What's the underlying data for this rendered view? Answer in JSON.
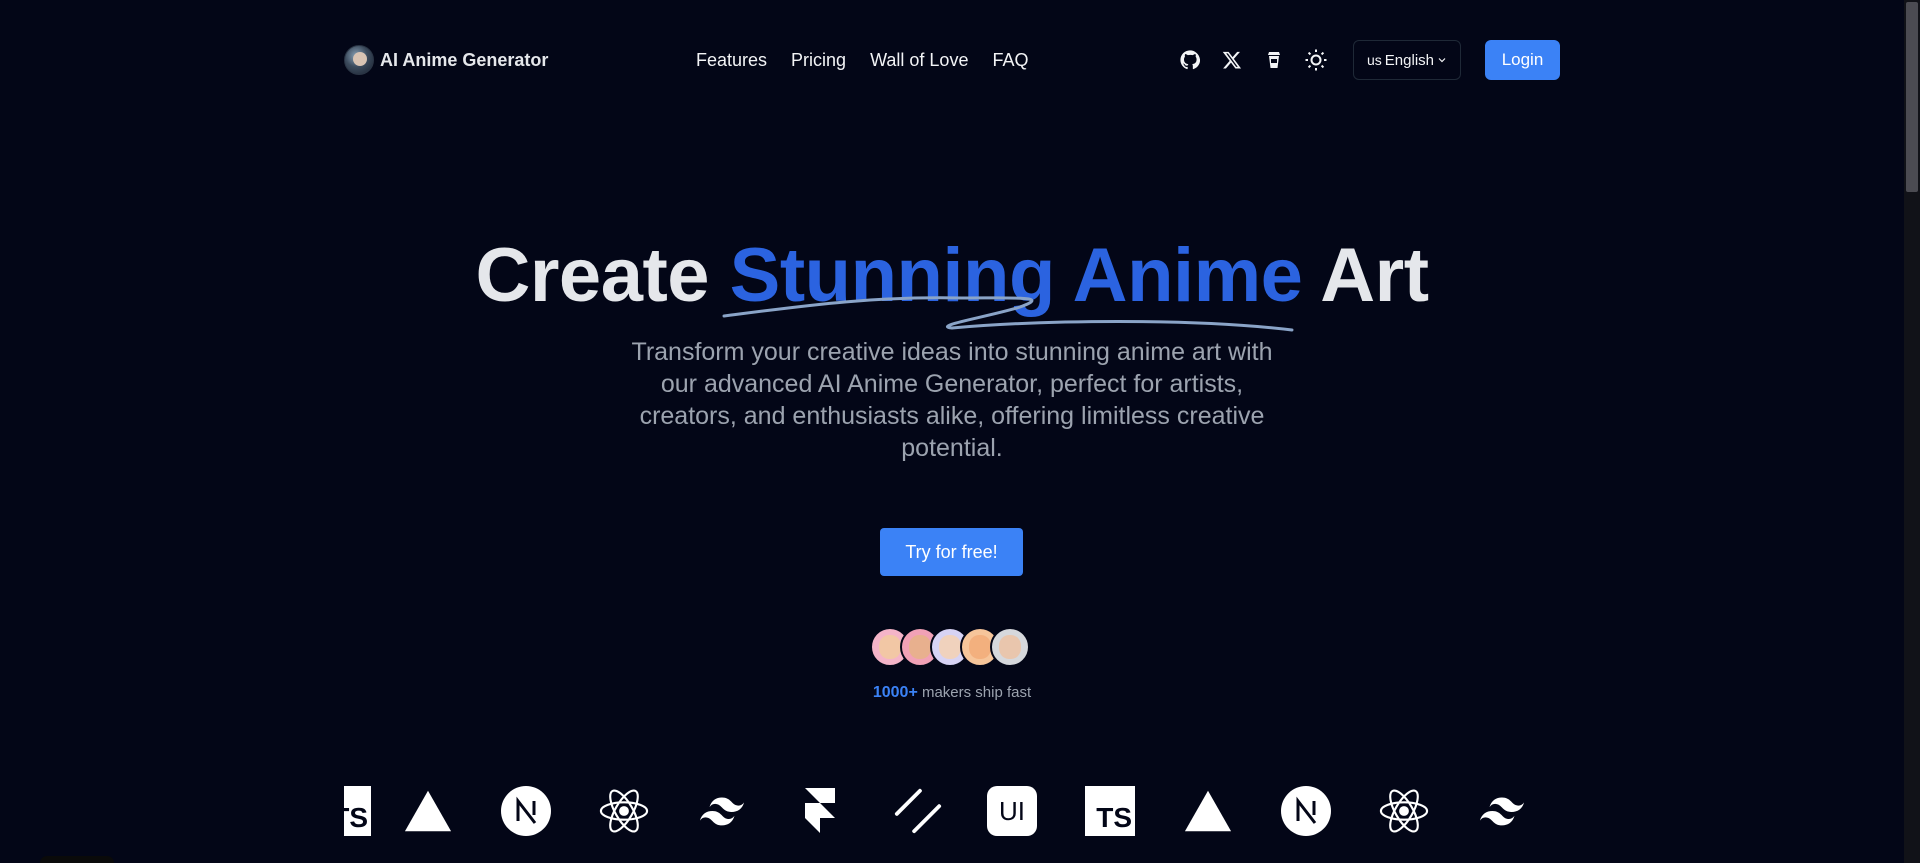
{
  "brand": {
    "name": "AI Anime Generator",
    "logo_icon": "anime-avatar-logo"
  },
  "nav": {
    "items": [
      "Features",
      "Pricing",
      "Wall of Love",
      "FAQ"
    ]
  },
  "actions": {
    "icons": [
      "github-icon",
      "x-icon",
      "coffee-icon",
      "sun-icon"
    ],
    "language": {
      "flag_code": "us",
      "label": "English"
    },
    "login_label": "Login"
  },
  "hero": {
    "title_start": "Create ",
    "title_accent": "Stunning Anime",
    "title_end": " Art",
    "subtitle": "Transform your creative ideas into stunning anime art with our advanced AI Anime Generator, perfect for artists, creators, and enthusiasts alike, offering limitless creative potential.",
    "cta_label": "Try for free!"
  },
  "social_proof": {
    "count": "1000+",
    "text": " makers ship fast"
  },
  "tech_strip": {
    "logos": [
      "typescript",
      "vercel",
      "nextjs",
      "react",
      "tailwind",
      "framer",
      "shadcn",
      "ui",
      "typescript",
      "vercel",
      "nextjs",
      "react",
      "tailwind"
    ],
    "ts_label": "TS",
    "ui_label": "UI"
  },
  "colors": {
    "background": "#030617",
    "accent": "#2b63e0",
    "button": "#3b82f6"
  }
}
